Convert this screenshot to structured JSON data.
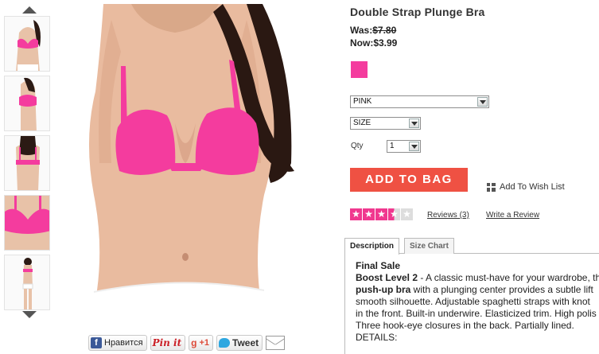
{
  "product": {
    "title": "Double Strap Plunge Bra",
    "was_label": "Was:",
    "was_price": "$7.80",
    "now_label": "Now:",
    "now_price": "$3.99",
    "swatch_color": "#f43c9e"
  },
  "options": {
    "color_value": "PINK",
    "size_value": "SIZE",
    "qty_label": "Qty",
    "qty_value": "1"
  },
  "actions": {
    "add_to_bag": "ADD TO BAG",
    "wish_list": "Add To Wish List",
    "reviews": "Reviews (3)",
    "write_review": "Write a Review"
  },
  "rating": {
    "value": 3.5,
    "max": 5
  },
  "tabs": [
    {
      "label": "Description"
    },
    {
      "label": "Size Chart"
    }
  ],
  "description": {
    "line1": "Final Sale",
    "line2_bold": "Boost Level 2",
    "line2_rest": " - A classic must-have for your wardrobe, th",
    "line3_bold": "push-up bra",
    "line3_rest": " with a plunging center provides a subtle lift ",
    "line4": "smooth silhouette. Adjustable spaghetti straps with knot",
    "line5": "in the front. Built-in underwire. Elasticized trim. High polis",
    "line6": "Three hook-eye closures in the back. Partially lined.",
    "line7": "DETAILS:"
  },
  "share": {
    "facebook": "Нравится",
    "pinterest": "Pin it",
    "gplus": "+1",
    "tweet": "Tweet"
  },
  "colors": {
    "accent": "#ef5143",
    "star": "#f0388f"
  }
}
